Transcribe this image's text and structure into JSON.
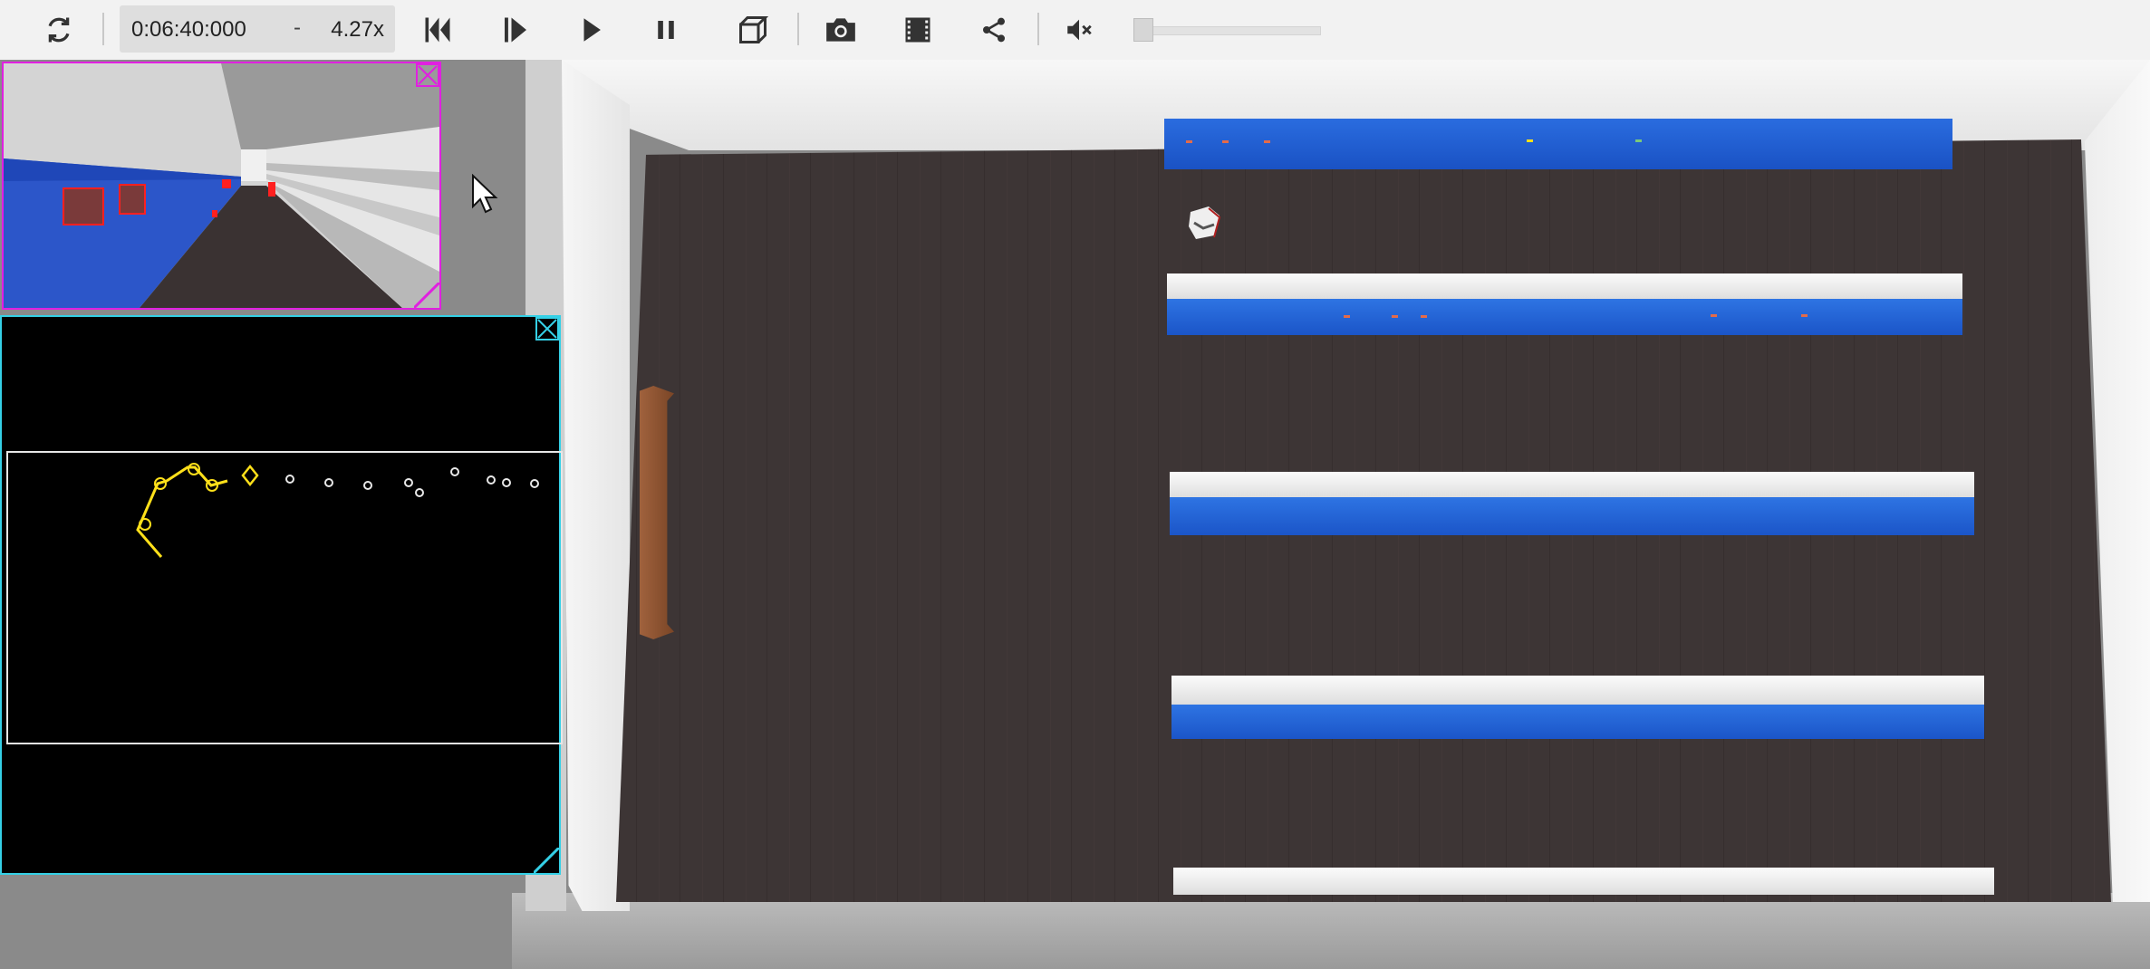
{
  "toolbar": {
    "time": "0:06:40:000",
    "time_separator": "-",
    "speed": "4.27x",
    "volume_level": 0.0,
    "icons": [
      "refresh-icon",
      "skip-to-start-icon",
      "step-forward-icon",
      "play-icon",
      "pause-icon",
      "3d-view-icon",
      "camera-icon",
      "film-icon",
      "share-icon",
      "mute-icon"
    ]
  },
  "colors": {
    "toolbar_bg": "#f2f2f2",
    "camera_border": "#e020e0",
    "map_border": "#35d0e6",
    "path_color": "#ffe01a",
    "shelf_blue": "#1f5fd4",
    "floor": "#3d3535"
  }
}
